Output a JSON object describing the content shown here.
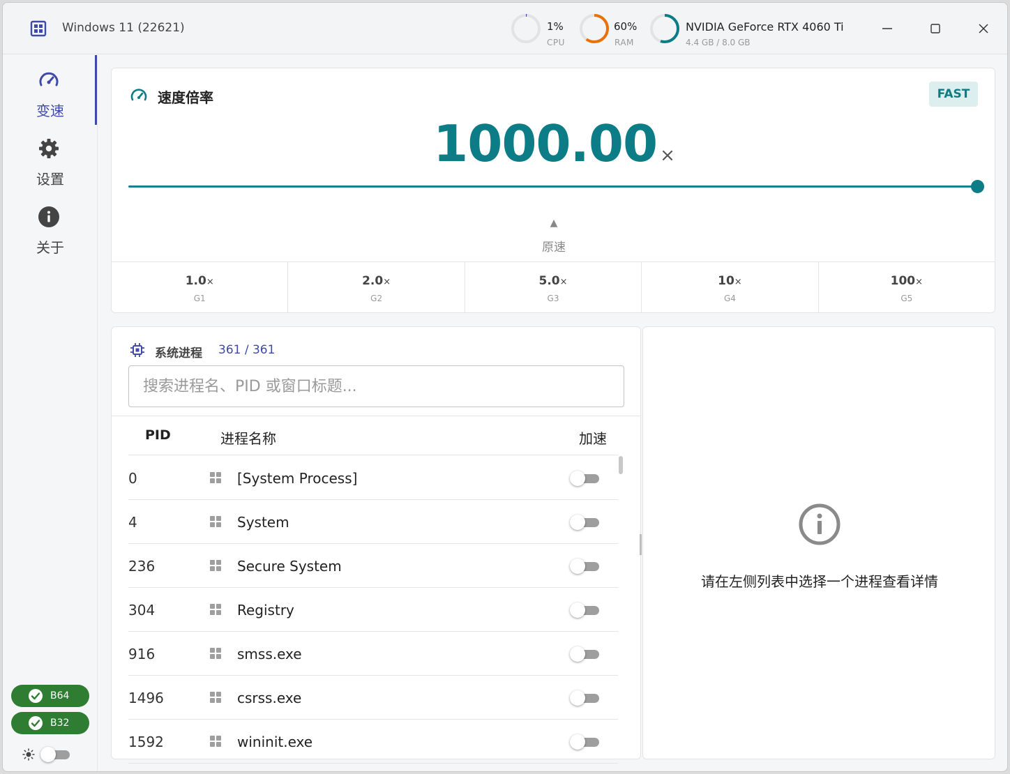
{
  "titlebar": {
    "app_icon": "cpu-grid-icon",
    "title": "Windows 11 (22621)",
    "cpu": {
      "value": "1%",
      "label": "CPU",
      "percent": 1,
      "color": "#3f4aa8"
    },
    "ram": {
      "value": "60%",
      "label": "RAM",
      "percent": 60,
      "color": "#e8710a"
    },
    "gpu": {
      "name": "NVIDIA GeForce RTX 4060 Ti",
      "memory": "4.4 GB / 8.0 GB",
      "percent": 55,
      "color": "#0c7c86"
    },
    "controls": [
      "minimize-icon",
      "maximize-icon",
      "close-icon"
    ]
  },
  "sidebar": {
    "items": [
      {
        "label": "变速",
        "icon": "speedometer-icon",
        "active": true
      },
      {
        "label": "设置",
        "icon": "gear-icon",
        "active": false
      },
      {
        "label": "关于",
        "icon": "info-icon",
        "active": false
      }
    ],
    "badges": [
      {
        "label": "B64",
        "status": "ok"
      },
      {
        "label": "B32",
        "status": "ok"
      }
    ],
    "theme": {
      "icon": "sun-icon",
      "dark_mode": false
    }
  },
  "speed": {
    "title": "速度倍率",
    "badge": "FAST",
    "value": "1000.00",
    "unit": "×",
    "slider_fraction": 1.0,
    "marker": "▲",
    "original_label": "原速",
    "presets": [
      {
        "value": "1.0",
        "unit": "×",
        "key": "G1"
      },
      {
        "value": "2.0",
        "unit": "×",
        "key": "G2"
      },
      {
        "value": "5.0",
        "unit": "×",
        "key": "G3"
      },
      {
        "value": "10",
        "unit": "×",
        "key": "G4"
      },
      {
        "value": "100",
        "unit": "×",
        "key": "G5"
      }
    ]
  },
  "processes": {
    "title": "系统进程",
    "count": "361 / 361",
    "search_placeholder": "搜索进程名、PID 或窗口标题...",
    "columns": {
      "pid": "PID",
      "name": "进程名称",
      "accelerate": "加速"
    },
    "rows": [
      {
        "pid": "0",
        "name": "[System Process]",
        "enabled": false
      },
      {
        "pid": "4",
        "name": "System",
        "enabled": false
      },
      {
        "pid": "236",
        "name": "Secure System",
        "enabled": false
      },
      {
        "pid": "304",
        "name": "Registry",
        "enabled": false
      },
      {
        "pid": "916",
        "name": "smss.exe",
        "enabled": false
      },
      {
        "pid": "1496",
        "name": "csrss.exe",
        "enabled": false
      },
      {
        "pid": "1592",
        "name": "wininit.exe",
        "enabled": false
      }
    ]
  },
  "detail": {
    "icon": "info-circle-icon",
    "message": "请在左侧列表中选择一个进程查看详情"
  },
  "colors": {
    "accent": "#0c7c86",
    "nav": "#3f4aa8",
    "ok": "#2e7d32",
    "ram": "#e8710a"
  }
}
